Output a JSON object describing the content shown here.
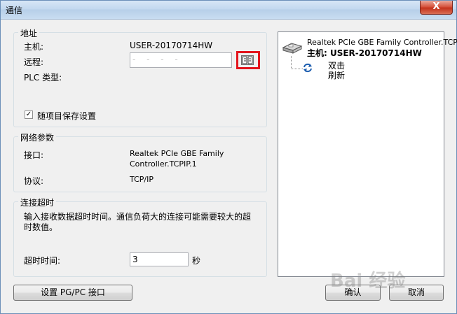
{
  "window": {
    "title": "通信",
    "close": "X"
  },
  "address": {
    "legend": "地址",
    "host_label": "主机:",
    "host_value": "USER-20170714HW",
    "remote_label": "远程:",
    "remote_value": "- - - -",
    "plc_type_label": "PLC 类型:",
    "save_label": "随项目保存设置",
    "save_checked": "✓"
  },
  "network": {
    "legend": "网络参数",
    "interface_label": "接口:",
    "interface_value_1": "Realtek PCIe GBE Family",
    "interface_value_2": "Controller.TCPIP.1",
    "protocol_label": "协议:",
    "protocol_value": "TCP/IP"
  },
  "timeout": {
    "legend": "连接超时",
    "description_1": "输入接收数据超时时间。通信负荷大的连接可能需要较大的超",
    "description_2": "时数值。",
    "timeout_label": "超时时间:",
    "timeout_value": "3",
    "unit": "秒"
  },
  "tree": {
    "adapter": "Realtek PCIe GBE Family Controller.TCPI",
    "host_line": "主机:  USER-20170714HW",
    "refresh_1": "双击",
    "refresh_2": "刷新"
  },
  "buttons": {
    "setup_pgpc": "设置 PG/PC 接口",
    "ok": "确认",
    "cancel": "取消"
  },
  "watermark": "Bai 经验"
}
